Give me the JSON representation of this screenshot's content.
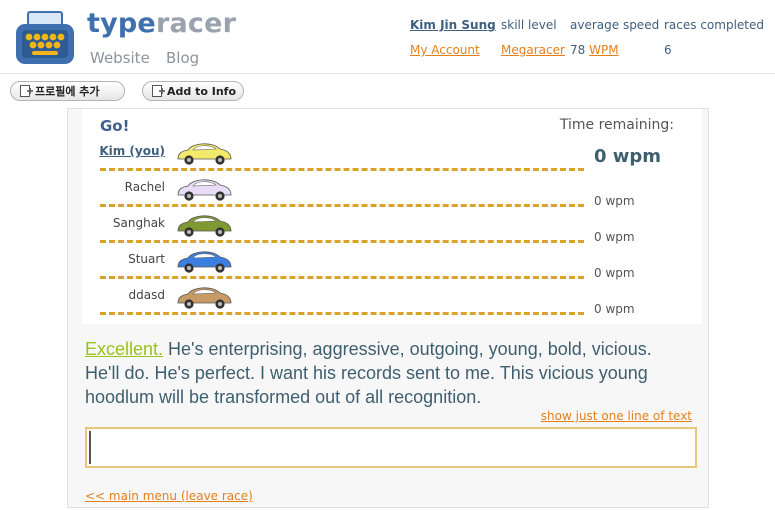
{
  "brand": {
    "part1": "type",
    "part2": "racer"
  },
  "nav": {
    "website": "Website",
    "blog": "Blog"
  },
  "user": {
    "name": "Kim Jin Sung",
    "skill_label": "skill level",
    "avg_label": "average speed",
    "races_label": "races completed",
    "my_account": "My Account",
    "skill_value": "Megaracer",
    "avg_value": "78",
    "avg_unit": "WPM",
    "races_value": "6"
  },
  "toolbar": {
    "add_profile": "프로필에 추가",
    "add_info": "Add to Info"
  },
  "race": {
    "go_label": "Go!",
    "time_remaining": "Time remaining:",
    "lanes": [
      {
        "name": "Kim (you)",
        "wpm": "0 wpm",
        "car_color": "#f2ea6a"
      },
      {
        "name": "Rachel",
        "wpm": "0 wpm",
        "car_color": "#e8dcf6"
      },
      {
        "name": "Sanghak",
        "wpm": "0 wpm",
        "car_color": "#7f9a32"
      },
      {
        "name": "Stuart",
        "wpm": "0 wpm",
        "car_color": "#3c7fe0"
      },
      {
        "name": "ddasd",
        "wpm": "0 wpm",
        "car_color": "#c89a66"
      }
    ]
  },
  "passage": {
    "typed_word": "Excellent.",
    "rest": " He's enterprising, aggressive, outgoing, young, bold, vicious. He'll do. He's perfect. I want his records sent to me. This vicious young hoodlum will be transformed out of all recognition."
  },
  "links": {
    "one_line": "show just one line of text",
    "main_menu": "<< main menu (leave race)"
  },
  "input": {
    "value": ""
  }
}
